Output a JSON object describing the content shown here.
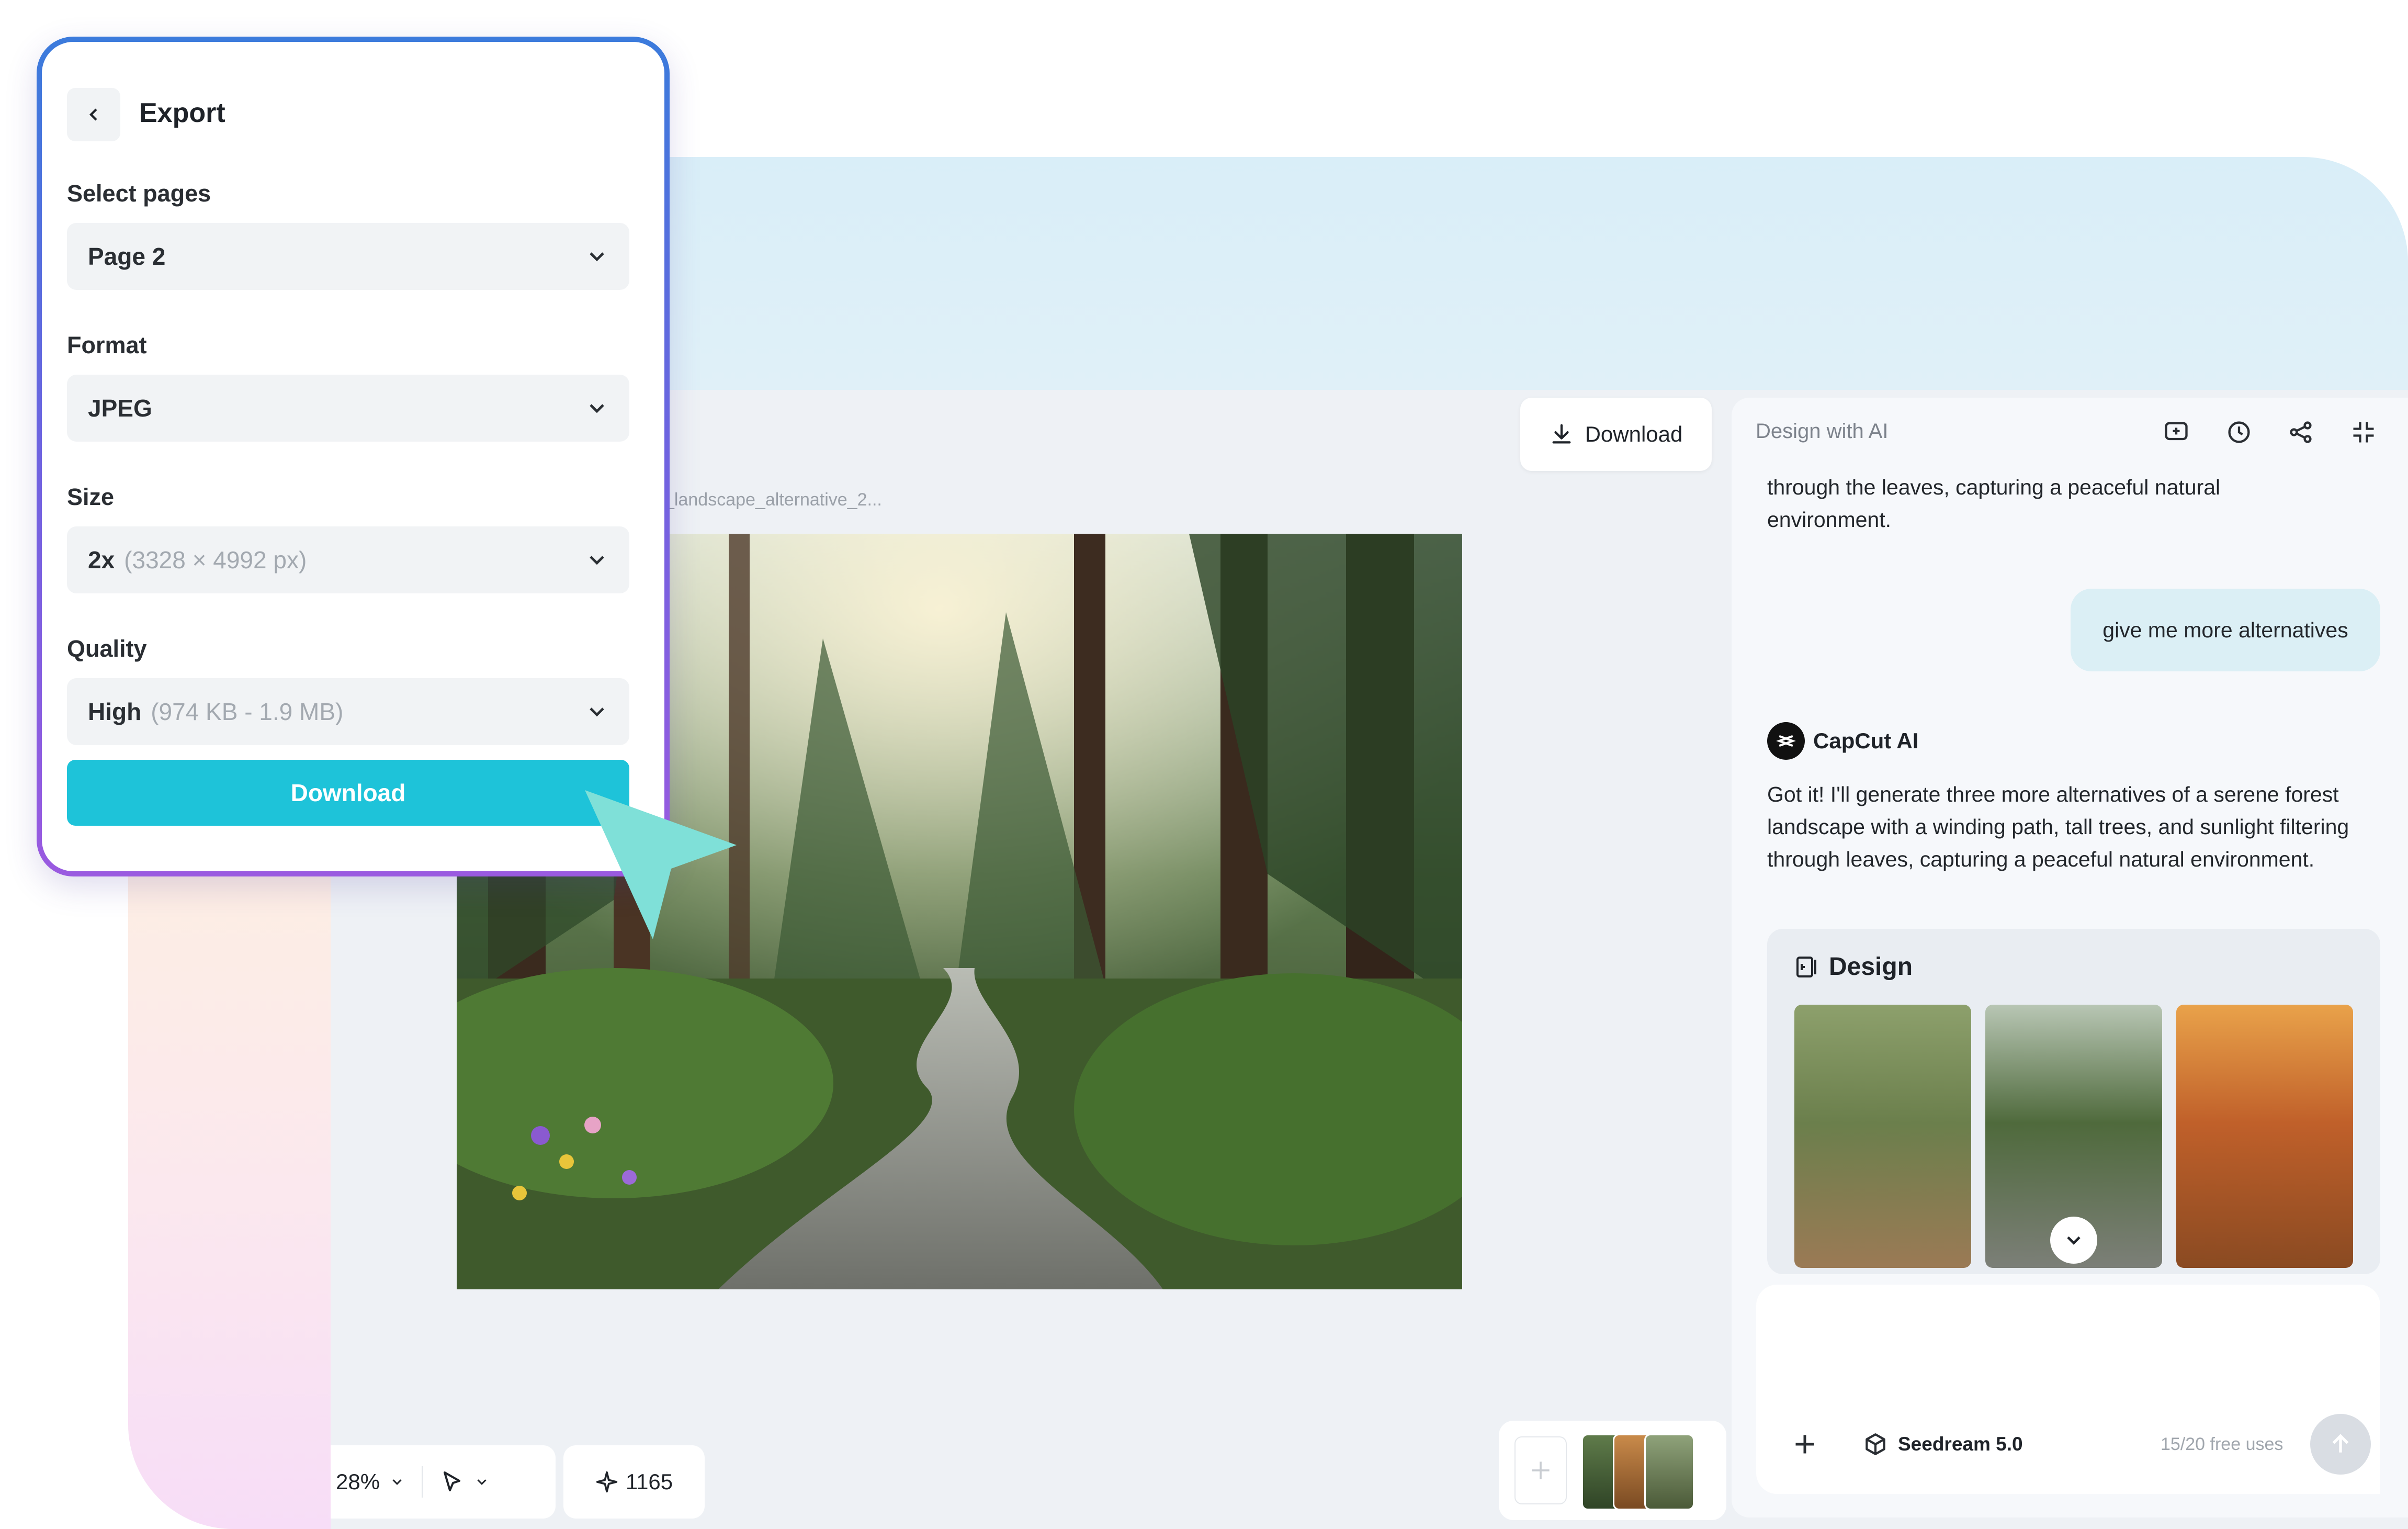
{
  "export": {
    "title": "Export",
    "select_pages_label": "Select pages",
    "select_pages_value": "Page 2",
    "format_label": "Format",
    "format_value": "JPEG",
    "size_label": "Size",
    "size_value": "2x",
    "size_hint": "(3328 × 4992 px)",
    "quality_label": "Quality",
    "quality_value": "High",
    "quality_hint": "(974 KB - 1.9 MB)",
    "download_label": "Download"
  },
  "canvas": {
    "filename": "_landscape_alternative_2...",
    "download_label": "Download"
  },
  "toolbar": {
    "zoom": "28%",
    "credits": "1165"
  },
  "ai_panel": {
    "title": "Design with AI",
    "prev_message": "through the leaves, capturing a peaceful natural environment.",
    "user_message": "give me more alternatives",
    "assistant_name": "CapCut AI",
    "assistant_message": "Got it! I'll generate three more alternatives of a serene forest landscape with a winding path, tall trees, and sunlight filtering through leaves, capturing a peaceful natural environment.",
    "design_label": "Design",
    "model_name": "Seedream 5.0",
    "free_uses": "15/20 free uses"
  },
  "colors": {
    "accent": "#1ec3d9",
    "cursor": "#7fe0d8",
    "user_bubble": "#dbeff5"
  }
}
